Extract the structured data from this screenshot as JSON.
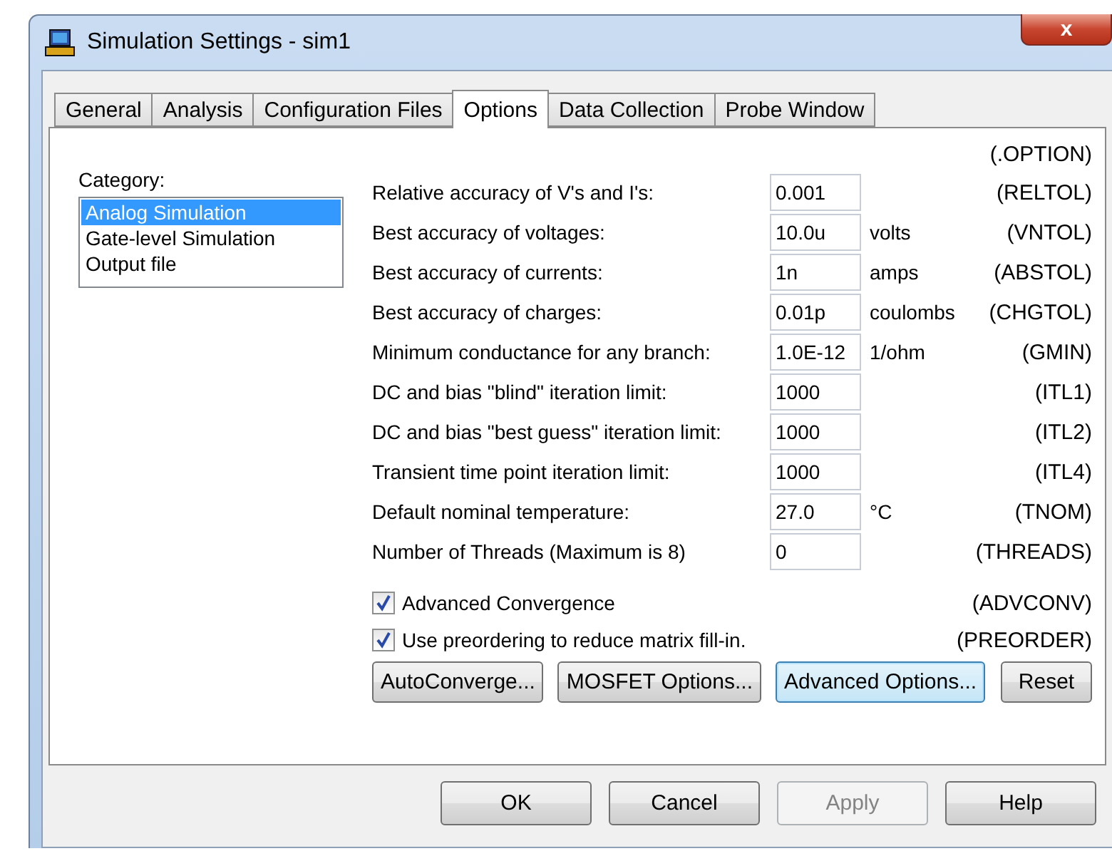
{
  "window": {
    "title": "Simulation Settings - sim1",
    "close": "x"
  },
  "tabs": [
    {
      "label": "General",
      "selected": false
    },
    {
      "label": "Analysis",
      "selected": false
    },
    {
      "label": "Configuration Files",
      "selected": false
    },
    {
      "label": "Options",
      "selected": true
    },
    {
      "label": "Data Collection",
      "selected": false
    },
    {
      "label": "Probe Window",
      "selected": false
    }
  ],
  "category": {
    "label": "Category:",
    "items": [
      {
        "label": "Analog Simulation",
        "selected": true
      },
      {
        "label": "Gate-level Simulation",
        "selected": false
      },
      {
        "label": "Output file",
        "selected": false
      }
    ]
  },
  "options_header": "(.OPTION)",
  "fields": [
    {
      "label": "Relative accuracy of V's and I's:",
      "value": "0.001",
      "code": "(RELTOL)"
    },
    {
      "label": "Best accuracy of voltages:",
      "value": "10.0u",
      "unit": "volts",
      "code": "(VNTOL)"
    },
    {
      "label": "Best accuracy of currents:",
      "value": "1n",
      "unit": "amps",
      "code": "(ABSTOL)"
    },
    {
      "label": "Best accuracy of charges:",
      "value": "0.01p",
      "unit": "coulombs",
      "code": "(CHGTOL)"
    },
    {
      "label": "Minimum conductance for any branch:",
      "value": "1.0E-12",
      "unit": "1/ohm",
      "code": "(GMIN)"
    },
    {
      "label": "DC and bias \"blind\" iteration limit:",
      "value": "1000",
      "code": "(ITL1)"
    },
    {
      "label": "DC and bias \"best guess\" iteration limit:",
      "value": "1000",
      "code": "(ITL2)"
    },
    {
      "label": "Transient time point iteration limit:",
      "value": "1000",
      "code": "(ITL4)"
    },
    {
      "label": "Default nominal temperature:",
      "value": "27.0",
      "unit": "°C",
      "code": "(TNOM)"
    },
    {
      "label": "Number of Threads (Maximum is 8)",
      "value": "0",
      "code": "(THREADS)"
    }
  ],
  "checkboxes": [
    {
      "label": "Advanced Convergence",
      "checked": true,
      "code": "(ADVCONV)"
    },
    {
      "label": "Use preordering to reduce matrix fill-in.",
      "checked": true,
      "code": "(PREORDER)"
    }
  ],
  "option_buttons": [
    {
      "label": "AutoConverge...",
      "focused": false
    },
    {
      "label": "MOSFET Options...",
      "focused": false
    },
    {
      "label": "Advanced Options...",
      "focused": true
    },
    {
      "label": "Reset",
      "focused": false
    }
  ],
  "dialog_buttons": [
    {
      "label": "OK",
      "disabled": false
    },
    {
      "label": "Cancel",
      "disabled": false
    },
    {
      "label": "Apply",
      "disabled": true
    },
    {
      "label": "Help",
      "disabled": false
    }
  ]
}
